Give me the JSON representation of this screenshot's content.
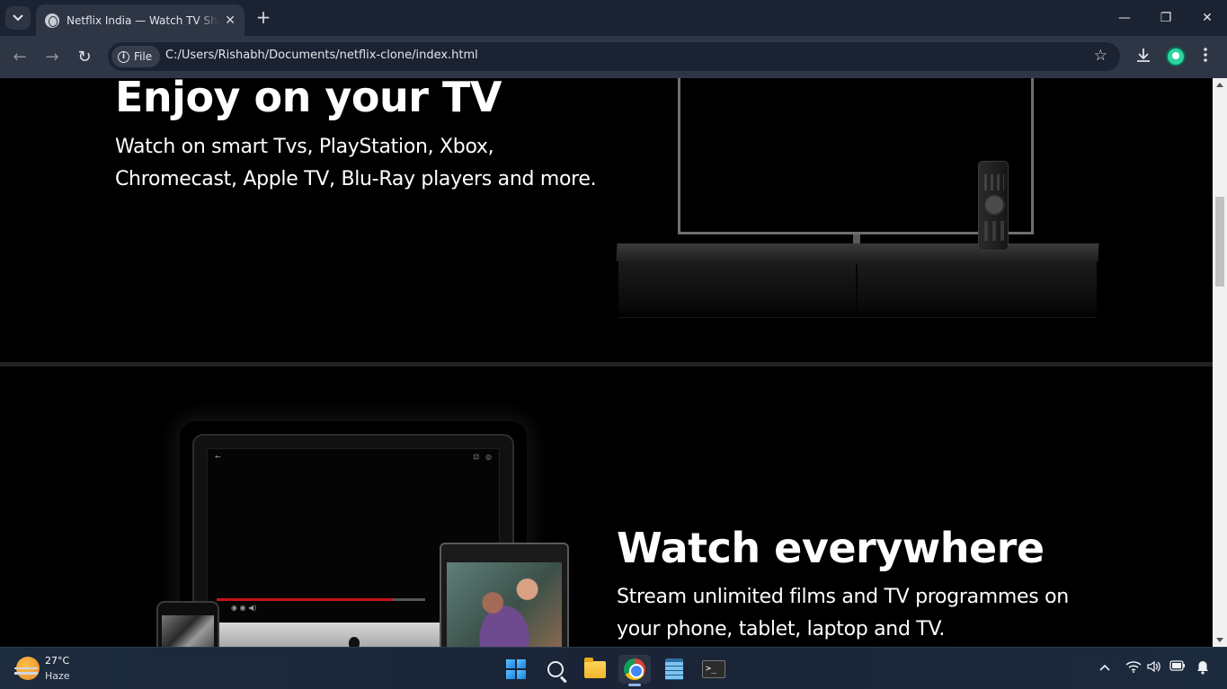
{
  "browser": {
    "tab_title": "Netflix India — Watch TV Shows Online, Watch Movies Online",
    "tab_close": "✕",
    "new_tab": "+",
    "window_controls": {
      "minimize": "—",
      "restore": "❐",
      "close": "✕"
    },
    "nav": {
      "back": "←",
      "forward": "→",
      "reload": "↻"
    },
    "address": {
      "scheme_label": "File",
      "url": "C:/Users/Rishabh/Documents/netflix-clone/index.html"
    },
    "icons": {
      "bookmark": "star-icon",
      "download": "download-icon",
      "profile": "profile-avatar",
      "menu": "more-vert-icon"
    }
  },
  "page": {
    "section_tv": {
      "heading": "Enjoy on your TV",
      "line1": "Watch on smart Tvs, PlayStation, Xbox,",
      "line2": "Chromecast, Apple TV, Blu-Ray players and more."
    },
    "section_everywhere": {
      "heading": "Watch everywhere",
      "line1": "Stream unlimited films and TV programmes on",
      "line2": "your phone, tablet, laptop and TV."
    },
    "colors": {
      "background": "#000000",
      "divider": "#232323",
      "progress": "#c4141b"
    }
  },
  "taskbar": {
    "weather": {
      "temperature": "27°C",
      "condition": "Haze"
    },
    "apps": [
      "start",
      "search",
      "file-explorer",
      "chrome",
      "notepad",
      "terminal"
    ],
    "active_app": "chrome",
    "tray": [
      "chevron-up-icon",
      "wifi-icon",
      "volume-icon",
      "battery-icon",
      "notification-bell-icon"
    ]
  }
}
